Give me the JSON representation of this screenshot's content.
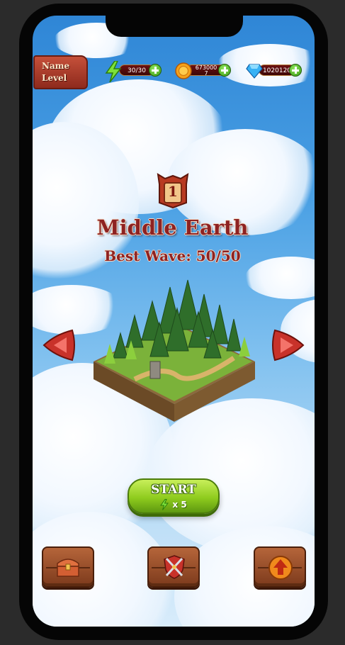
{
  "player": {
    "name_label": "Name",
    "level_label": "Level"
  },
  "hud": {
    "energy": {
      "icon": "lightning-icon",
      "value": "30/30"
    },
    "coins": {
      "icon": "coin-icon",
      "value": "6730007"
    },
    "gems": {
      "icon": "gem-icon",
      "value": "1020120"
    }
  },
  "level": {
    "number": "1",
    "name": "Middle Earth",
    "best_wave": "Best Wave: 50/50"
  },
  "start_button": {
    "label": "START",
    "cost_multiplier": "x 5",
    "cost_icon": "lightning-icon"
  },
  "bottom_buttons": [
    {
      "icon": "treasure-chest-icon"
    },
    {
      "icon": "shield-swords-icon"
    },
    {
      "icon": "upgrade-arrow-icon"
    }
  ],
  "colors": {
    "title": "#8e2222",
    "start_green": "#8fcc1e",
    "wood": "#9a4e2a"
  }
}
